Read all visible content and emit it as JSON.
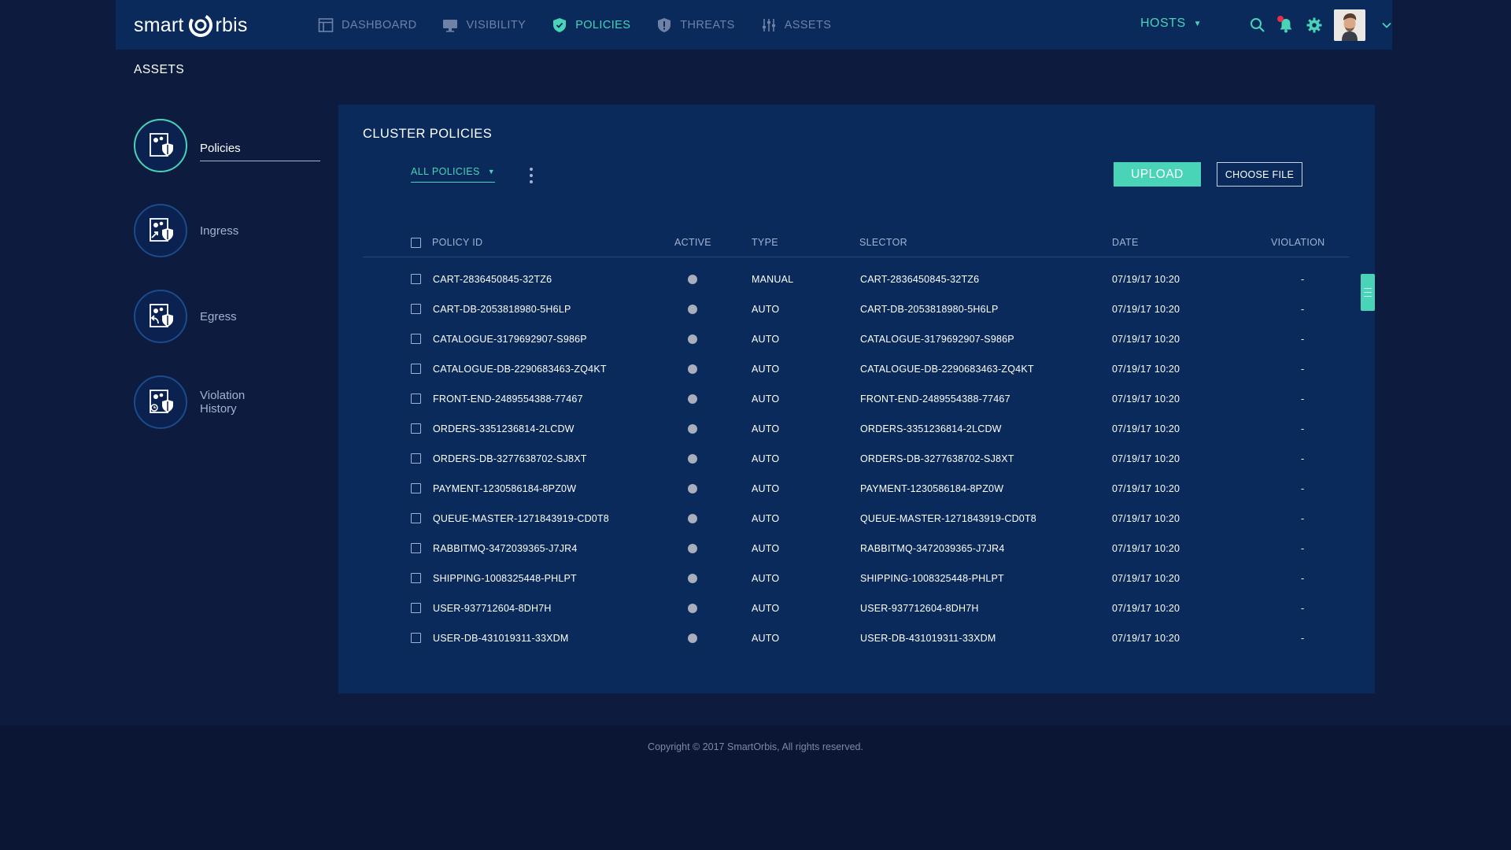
{
  "brand": {
    "text_left": "smart",
    "text_right": "rbis"
  },
  "nav": {
    "items": [
      {
        "label": "DASHBOARD",
        "icon": "dashboard-icon",
        "active": false
      },
      {
        "label": "VISIBILITY",
        "icon": "monitor-icon",
        "active": false
      },
      {
        "label": "POLICIES",
        "icon": "shield-check-icon",
        "active": true
      },
      {
        "label": "THREATS",
        "icon": "shield-alert-icon",
        "active": false
      },
      {
        "label": "ASSETS",
        "icon": "sliders-icon",
        "active": false
      }
    ],
    "hosts_label": "HOSTS"
  },
  "page_label": "ASSETS",
  "sidebar": {
    "items": [
      {
        "label": "Policies",
        "active": true
      },
      {
        "label": "Ingress",
        "active": false
      },
      {
        "label": "Egress",
        "active": false
      },
      {
        "label_line1": "Violation",
        "label_line2": "History",
        "active": false
      }
    ]
  },
  "panel": {
    "title": "CLUSTER POLICIES",
    "filter_label": "ALL POLICIES",
    "upload_label": "UPLOAD",
    "choose_file_label": "CHOOSE FILE"
  },
  "table": {
    "headers": {
      "policy_id": "POLICY ID",
      "active": "ACTIVE",
      "type": "TYPE",
      "selector": "SLECTOR",
      "date": "DATE",
      "violation": "VIOLATION"
    },
    "rows": [
      {
        "policy_id": "CART-2836450845-32TZ6",
        "type": "MANUAL",
        "selector": "CART-2836450845-32TZ6",
        "date": "07/19/17 10:20",
        "violation": "-"
      },
      {
        "policy_id": "CART-DB-2053818980-5H6LP",
        "type": "AUTO",
        "selector": "CART-DB-2053818980-5H6LP",
        "date": "07/19/17 10:20",
        "violation": "-"
      },
      {
        "policy_id": "CATALOGUE-3179692907-S986P",
        "type": "AUTO",
        "selector": "CATALOGUE-3179692907-S986P",
        "date": "07/19/17 10:20",
        "violation": "-"
      },
      {
        "policy_id": "CATALOGUE-DB-2290683463-ZQ4KT",
        "type": "AUTO",
        "selector": "CATALOGUE-DB-2290683463-ZQ4KT",
        "date": "07/19/17 10:20",
        "violation": "-"
      },
      {
        "policy_id": "FRONT-END-2489554388-77467",
        "type": "AUTO",
        "selector": "FRONT-END-2489554388-77467",
        "date": "07/19/17 10:20",
        "violation": "-"
      },
      {
        "policy_id": "ORDERS-3351236814-2LCDW",
        "type": "AUTO",
        "selector": "ORDERS-3351236814-2LCDW",
        "date": "07/19/17 10:20",
        "violation": "-"
      },
      {
        "policy_id": "ORDERS-DB-3277638702-SJ8XT",
        "type": "AUTO",
        "selector": "ORDERS-DB-3277638702-SJ8XT",
        "date": "07/19/17 10:20",
        "violation": "-"
      },
      {
        "policy_id": "PAYMENT-1230586184-8PZ0W",
        "type": "AUTO",
        "selector": "PAYMENT-1230586184-8PZ0W",
        "date": "07/19/17 10:20",
        "violation": "-"
      },
      {
        "policy_id": "QUEUE-MASTER-1271843919-CD0T8",
        "type": "AUTO",
        "selector": "QUEUE-MASTER-1271843919-CD0T8",
        "date": "07/19/17 10:20",
        "violation": "-"
      },
      {
        "policy_id": "RABBITMQ-3472039365-J7JR4",
        "type": "AUTO",
        "selector": "RABBITMQ-3472039365-J7JR4",
        "date": "07/19/17 10:20",
        "violation": "-"
      },
      {
        "policy_id": "SHIPPING-1008325448-PHLPT",
        "type": "AUTO",
        "selector": "SHIPPING-1008325448-PHLPT",
        "date": "07/19/17 10:20",
        "violation": "-"
      },
      {
        "policy_id": "USER-937712604-8DH7H",
        "type": "AUTO",
        "selector": "USER-937712604-8DH7H",
        "date": "07/19/17 10:20",
        "violation": "-"
      },
      {
        "policy_id": "USER-DB-431019311-33XDM",
        "type": "AUTO",
        "selector": "USER-DB-431019311-33XDM",
        "date": "07/19/17 10:20",
        "violation": "-"
      }
    ]
  },
  "footer": {
    "copyright": "Copyright © 2017 SmartOrbis, All rights reserved."
  },
  "colors": {
    "accent": "#49d3b7",
    "background": "#0c1b3e",
    "panel": "#0a2a5c",
    "notification": "#e62e4d"
  }
}
